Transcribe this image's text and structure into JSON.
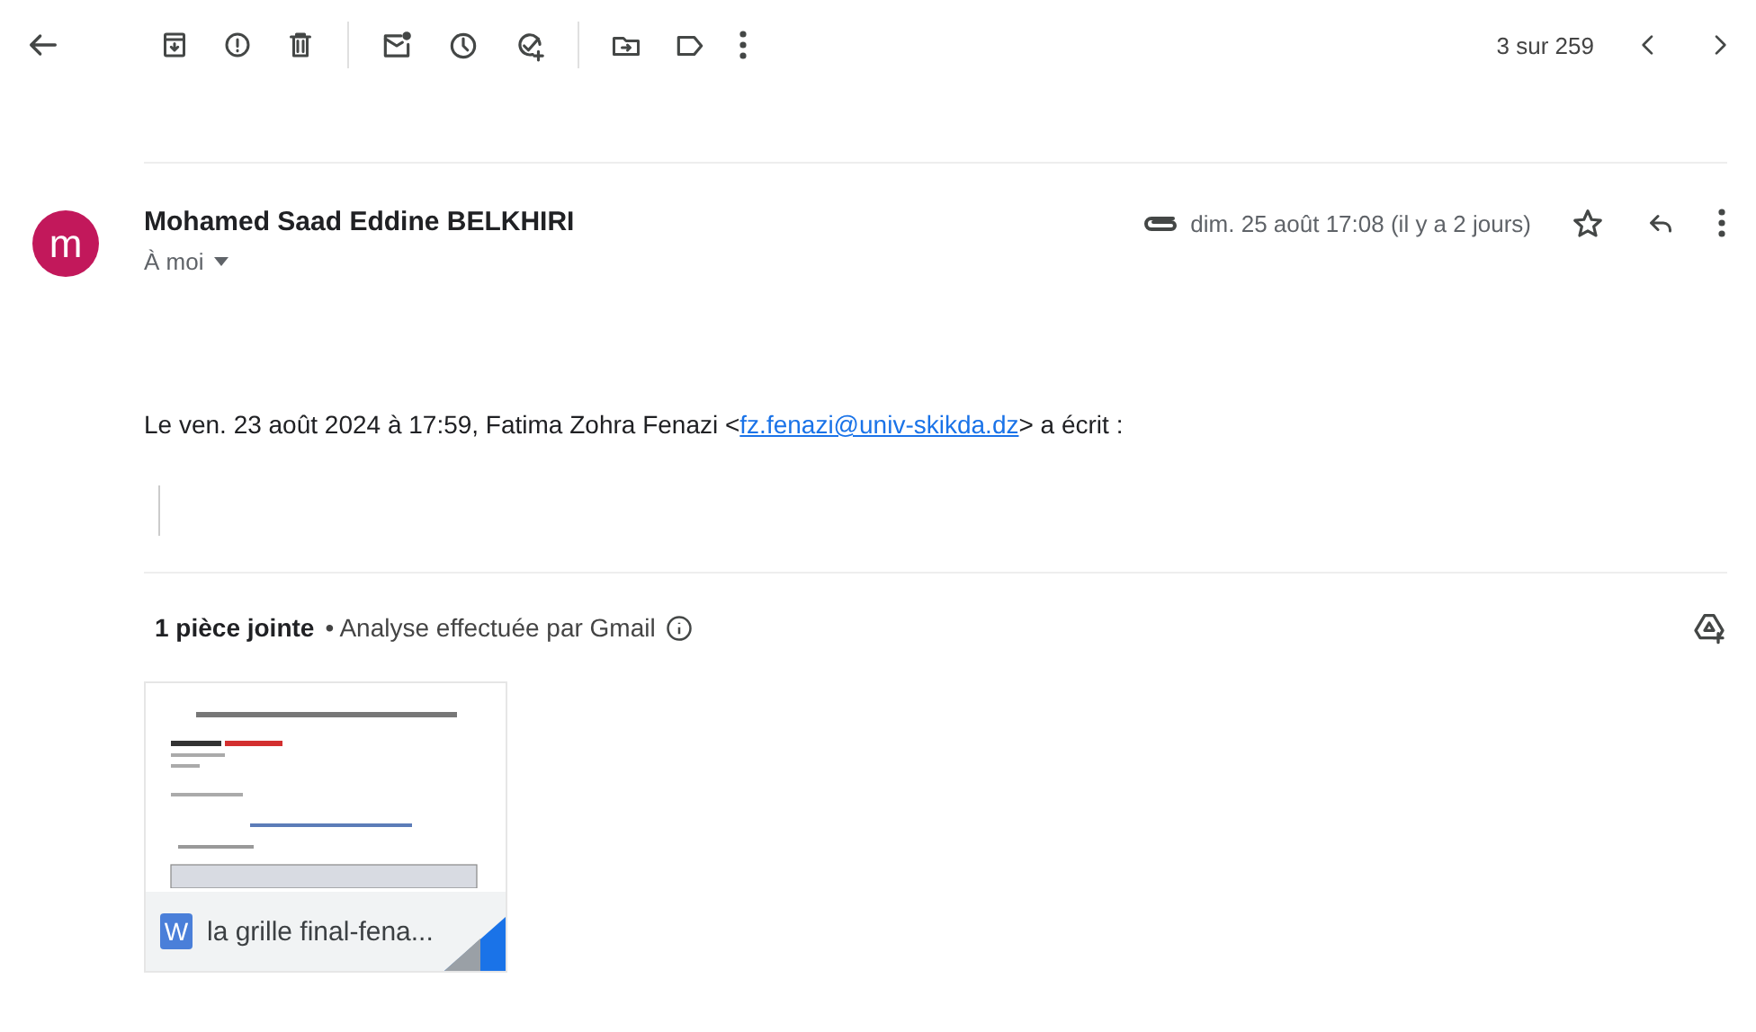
{
  "toolbar": {
    "counter": "3 sur 259"
  },
  "message": {
    "avatar_letter": "m",
    "sender": "Mohamed Saad Eddine BELKHIRI",
    "recipient": "À moi",
    "date": "dim. 25 août 17:08 (il y a 2 jours)",
    "body": {
      "intro": "Le ven. 23 août 2024 à 17:59, Fatima Zohra Fenazi <",
      "email": "fz.fenazi@univ-skikda.dz",
      "outro": "> a écrit :"
    }
  },
  "attachments": {
    "count_label": "1 pièce jointe",
    "scan_note": "• Analyse effectuée par Gmail",
    "files": [
      {
        "kind": "word",
        "type_letter": "W",
        "name": "la grille final-fena..."
      }
    ]
  }
}
